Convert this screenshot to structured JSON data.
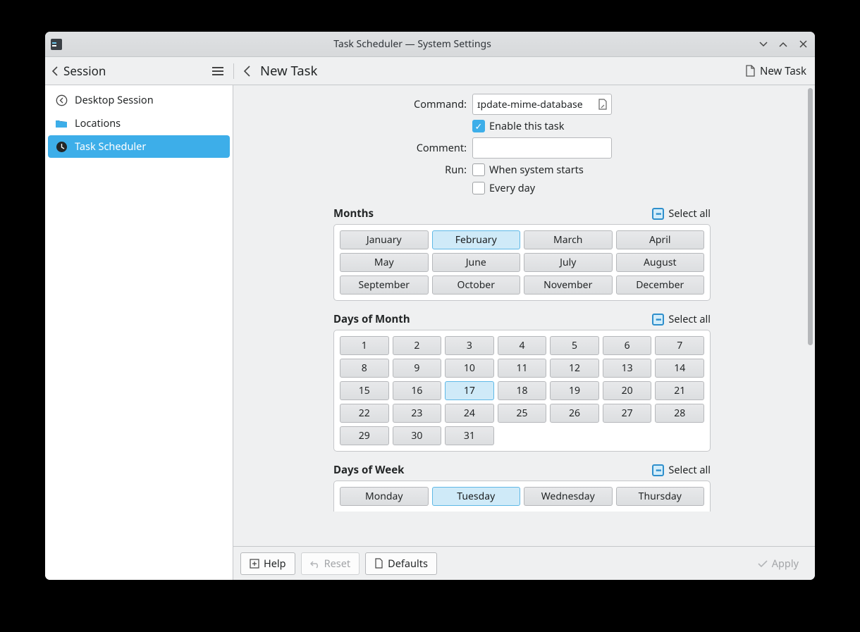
{
  "window": {
    "title": "Task Scheduler — System Settings"
  },
  "breadcrumb": {
    "back_label": "Session"
  },
  "page": {
    "title": "New Task",
    "new_task_label": "New Task"
  },
  "sidebar": {
    "items": [
      {
        "label": "Desktop Session"
      },
      {
        "label": "Locations"
      },
      {
        "label": "Task Scheduler"
      }
    ]
  },
  "form": {
    "command_label": "Command:",
    "command_value": "ɪpdate-mime-database",
    "enable_label": "Enable this task",
    "comment_label": "Comment:",
    "comment_value": "",
    "run_label": "Run:",
    "run_option1": "When system starts",
    "run_option2": "Every day"
  },
  "select_all_label": "Select all",
  "months": {
    "title": "Months",
    "items": [
      "January",
      "February",
      "March",
      "April",
      "May",
      "June",
      "July",
      "August",
      "September",
      "October",
      "November",
      "December"
    ],
    "selected": [
      "February"
    ]
  },
  "days_of_month": {
    "title": "Days of Month",
    "items": [
      "1",
      "2",
      "3",
      "4",
      "5",
      "6",
      "7",
      "8",
      "9",
      "10",
      "11",
      "12",
      "13",
      "14",
      "15",
      "16",
      "17",
      "18",
      "19",
      "20",
      "21",
      "22",
      "23",
      "24",
      "25",
      "26",
      "27",
      "28",
      "29",
      "30",
      "31"
    ],
    "selected": [
      "17"
    ]
  },
  "days_of_week": {
    "title": "Days of Week",
    "items": [
      "Monday",
      "Tuesday",
      "Wednesday",
      "Thursday"
    ],
    "selected": [
      "Tuesday"
    ]
  },
  "buttons": {
    "help": "Help",
    "reset": "Reset",
    "defaults": "Defaults",
    "apply": "Apply"
  }
}
